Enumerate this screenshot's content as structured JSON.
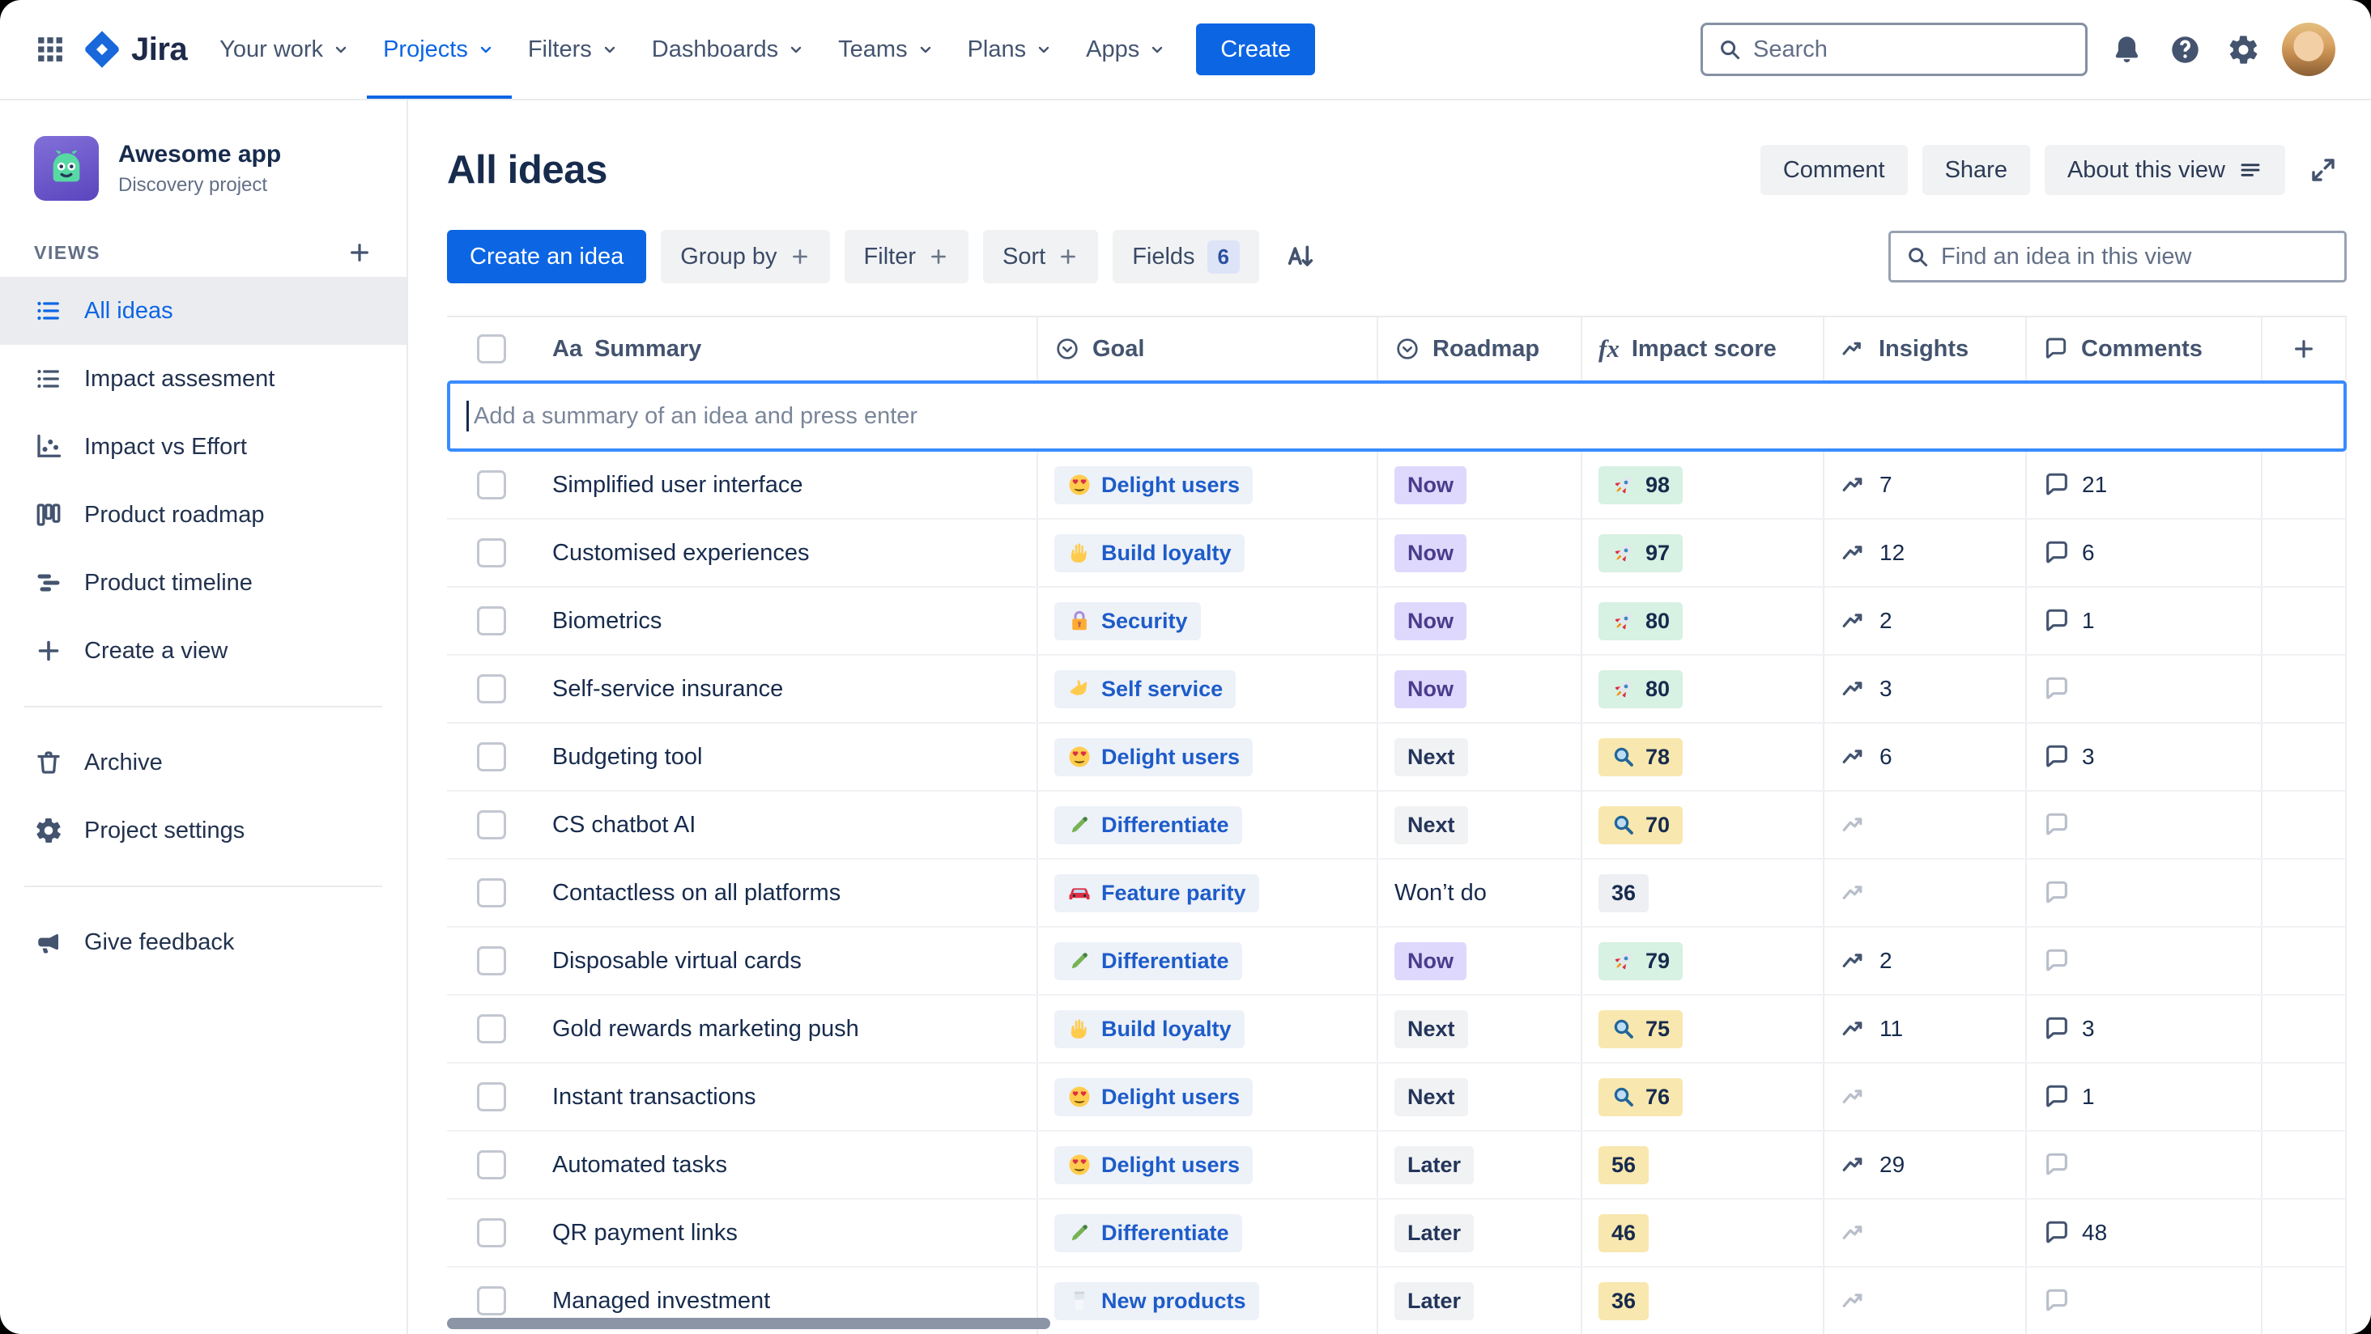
{
  "nav": {
    "product": "Jira",
    "menu": [
      "Your work",
      "Projects",
      "Filters",
      "Dashboards",
      "Teams",
      "Plans",
      "Apps"
    ],
    "active_index": 1,
    "create_label": "Create",
    "search_placeholder": "Search"
  },
  "sidebar": {
    "project": {
      "name": "Awesome app",
      "type": "Discovery project"
    },
    "views_label": "VIEWS",
    "views": [
      {
        "label": "All ideas",
        "icon": "list",
        "selected": true
      },
      {
        "label": "Impact assesment",
        "icon": "list"
      },
      {
        "label": "Impact vs Effort",
        "icon": "scatter"
      },
      {
        "label": "Product roadmap",
        "icon": "board"
      },
      {
        "label": "Product timeline",
        "icon": "timeline"
      },
      {
        "label": "Create a view",
        "icon": "plus"
      }
    ],
    "footer": [
      {
        "label": "Archive",
        "icon": "trash"
      },
      {
        "label": "Project settings",
        "icon": "gear"
      }
    ],
    "feedback": {
      "label": "Give feedback",
      "icon": "megaphone"
    }
  },
  "header": {
    "title": "All ideas",
    "actions": [
      "Comment",
      "Share",
      "About this view"
    ]
  },
  "toolbar": {
    "create_idea": "Create an idea",
    "group_by": "Group by",
    "filter": "Filter",
    "sort": "Sort",
    "fields": "Fields",
    "fields_count": "6",
    "find_placeholder": "Find an idea in this view"
  },
  "table": {
    "add_placeholder": "Add a summary of an idea and press enter",
    "columns": [
      {
        "label": "Summary",
        "icon_glyph": "Aa"
      },
      {
        "label": "Goal"
      },
      {
        "label": "Roadmap"
      },
      {
        "label": "Impact score",
        "icon_glyph": "fx"
      },
      {
        "label": "Insights"
      },
      {
        "label": "Comments"
      }
    ],
    "rows": [
      {
        "summary": "Simplified user interface",
        "goal": {
          "label": "Delight users",
          "icon": "face-hearts"
        },
        "roadmap": {
          "label": "Now",
          "color": "purple"
        },
        "impact": {
          "value": "98",
          "icon": "rocket",
          "color": "green"
        },
        "insights": "7",
        "comments": "21"
      },
      {
        "summary": "Customised experiences",
        "goal": {
          "label": "Build loyalty",
          "icon": "hand"
        },
        "roadmap": {
          "label": "Now",
          "color": "purple"
        },
        "impact": {
          "value": "97",
          "icon": "rocket",
          "color": "green"
        },
        "insights": "12",
        "comments": "6"
      },
      {
        "summary": "Biometrics",
        "goal": {
          "label": "Security",
          "icon": "lock"
        },
        "roadmap": {
          "label": "Now",
          "color": "purple"
        },
        "impact": {
          "value": "80",
          "icon": "rocket",
          "color": "green"
        },
        "insights": "2",
        "comments": "1"
      },
      {
        "summary": "Self-service insurance",
        "goal": {
          "label": "Self service",
          "icon": "callme"
        },
        "roadmap": {
          "label": "Now",
          "color": "purple"
        },
        "impact": {
          "value": "80",
          "icon": "rocket",
          "color": "green"
        },
        "insights": "3",
        "comments": ""
      },
      {
        "summary": "Budgeting tool",
        "goal": {
          "label": "Delight users",
          "icon": "face-hearts"
        },
        "roadmap": {
          "label": "Next",
          "color": "gray"
        },
        "impact": {
          "value": "78",
          "icon": "magnifier",
          "color": "yellow"
        },
        "insights": "6",
        "comments": "3"
      },
      {
        "summary": "CS chatbot AI",
        "goal": {
          "label": "Differentiate",
          "icon": "crayon"
        },
        "roadmap": {
          "label": "Next",
          "color": "gray"
        },
        "impact": {
          "value": "70",
          "icon": "magnifier",
          "color": "yellow"
        },
        "insights": "",
        "comments": ""
      },
      {
        "summary": "Contactless on all platforms",
        "goal": {
          "label": "Feature parity",
          "icon": "car"
        },
        "roadmap": {
          "label": "Won’t do",
          "color": "none"
        },
        "impact": {
          "value": "36",
          "icon": "",
          "color": "gray"
        },
        "insights": "",
        "comments": ""
      },
      {
        "summary": "Disposable virtual cards",
        "goal": {
          "label": "Differentiate",
          "icon": "crayon"
        },
        "roadmap": {
          "label": "Now",
          "color": "purple"
        },
        "impact": {
          "value": "79",
          "icon": "rocket",
          "color": "green"
        },
        "insights": "2",
        "comments": ""
      },
      {
        "summary": "Gold rewards marketing push",
        "goal": {
          "label": "Build loyalty",
          "icon": "hand"
        },
        "roadmap": {
          "label": "Next",
          "color": "gray"
        },
        "impact": {
          "value": "75",
          "icon": "magnifier",
          "color": "yellow"
        },
        "insights": "11",
        "comments": "3"
      },
      {
        "summary": "Instant transactions",
        "goal": {
          "label": "Delight users",
          "icon": "face-hearts"
        },
        "roadmap": {
          "label": "Next",
          "color": "gray"
        },
        "impact": {
          "value": "76",
          "icon": "magnifier",
          "color": "yellow"
        },
        "insights": "",
        "comments": "1"
      },
      {
        "summary": "Automated tasks",
        "goal": {
          "label": "Delight users",
          "icon": "face-hearts"
        },
        "roadmap": {
          "label": "Later",
          "color": "gray"
        },
        "impact": {
          "value": "56",
          "icon": "",
          "color": "yellow"
        },
        "insights": "29",
        "comments": ""
      },
      {
        "summary": "QR payment links",
        "goal": {
          "label": "Differentiate",
          "icon": "crayon"
        },
        "roadmap": {
          "label": "Later",
          "color": "gray"
        },
        "impact": {
          "value": "46",
          "icon": "",
          "color": "yellow"
        },
        "insights": "",
        "comments": "48"
      },
      {
        "summary": "Managed investment",
        "goal": {
          "label": "New products",
          "icon": "glass"
        },
        "roadmap": {
          "label": "Later",
          "color": "gray"
        },
        "impact": {
          "value": "36",
          "icon": "",
          "color": "yellow"
        },
        "insights": "",
        "comments": ""
      }
    ]
  },
  "colors": {
    "accent_blue": "#0C66E4",
    "roadmap_now_bg": "#DFD8FD",
    "impact_green_bg": "#D7F1E3",
    "impact_yellow_bg": "#F8E7AE",
    "focus_border": "#388BFF"
  }
}
